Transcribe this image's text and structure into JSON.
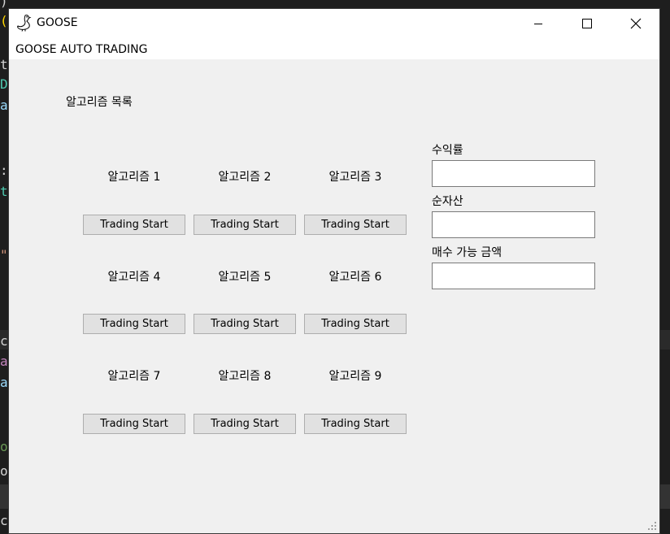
{
  "window": {
    "title": "GOOSE",
    "menu_label": "GOOSE AUTO TRADING"
  },
  "algorithm_list": {
    "heading": "알고리즘 목록",
    "algorithms": [
      {
        "label": "알고리즘 1",
        "button": "Trading Start"
      },
      {
        "label": "알고리즘 2",
        "button": "Trading Start"
      },
      {
        "label": "알고리즘 3",
        "button": "Trading Start"
      },
      {
        "label": "알고리즘 4",
        "button": "Trading Start"
      },
      {
        "label": "알고리즘 5",
        "button": "Trading Start"
      },
      {
        "label": "알고리즘 6",
        "button": "Trading Start"
      },
      {
        "label": "알고리즘 7",
        "button": "Trading Start"
      },
      {
        "label": "알고리즘 8",
        "button": "Trading Start"
      },
      {
        "label": "알고리즘 9",
        "button": "Trading Start"
      }
    ]
  },
  "account": {
    "return_rate_label": "수익률",
    "return_rate_value": "",
    "net_assets_label": "순자산",
    "net_assets_value": "",
    "buying_power_label": "매수 가능 금액",
    "buying_power_value": ""
  },
  "background_editor": {
    "chars": [
      ")",
      "(",
      "t",
      "D",
      "a",
      ":",
      "t",
      "\"",
      "c",
      "a",
      "a",
      "o",
      "o",
      "c"
    ]
  },
  "colors": {
    "window_bg": "#f0f0f0",
    "titlebar_bg": "#ffffff",
    "button_bg": "#e1e1e1",
    "button_border": "#adadad",
    "editor_bg": "#1e1e1e"
  }
}
